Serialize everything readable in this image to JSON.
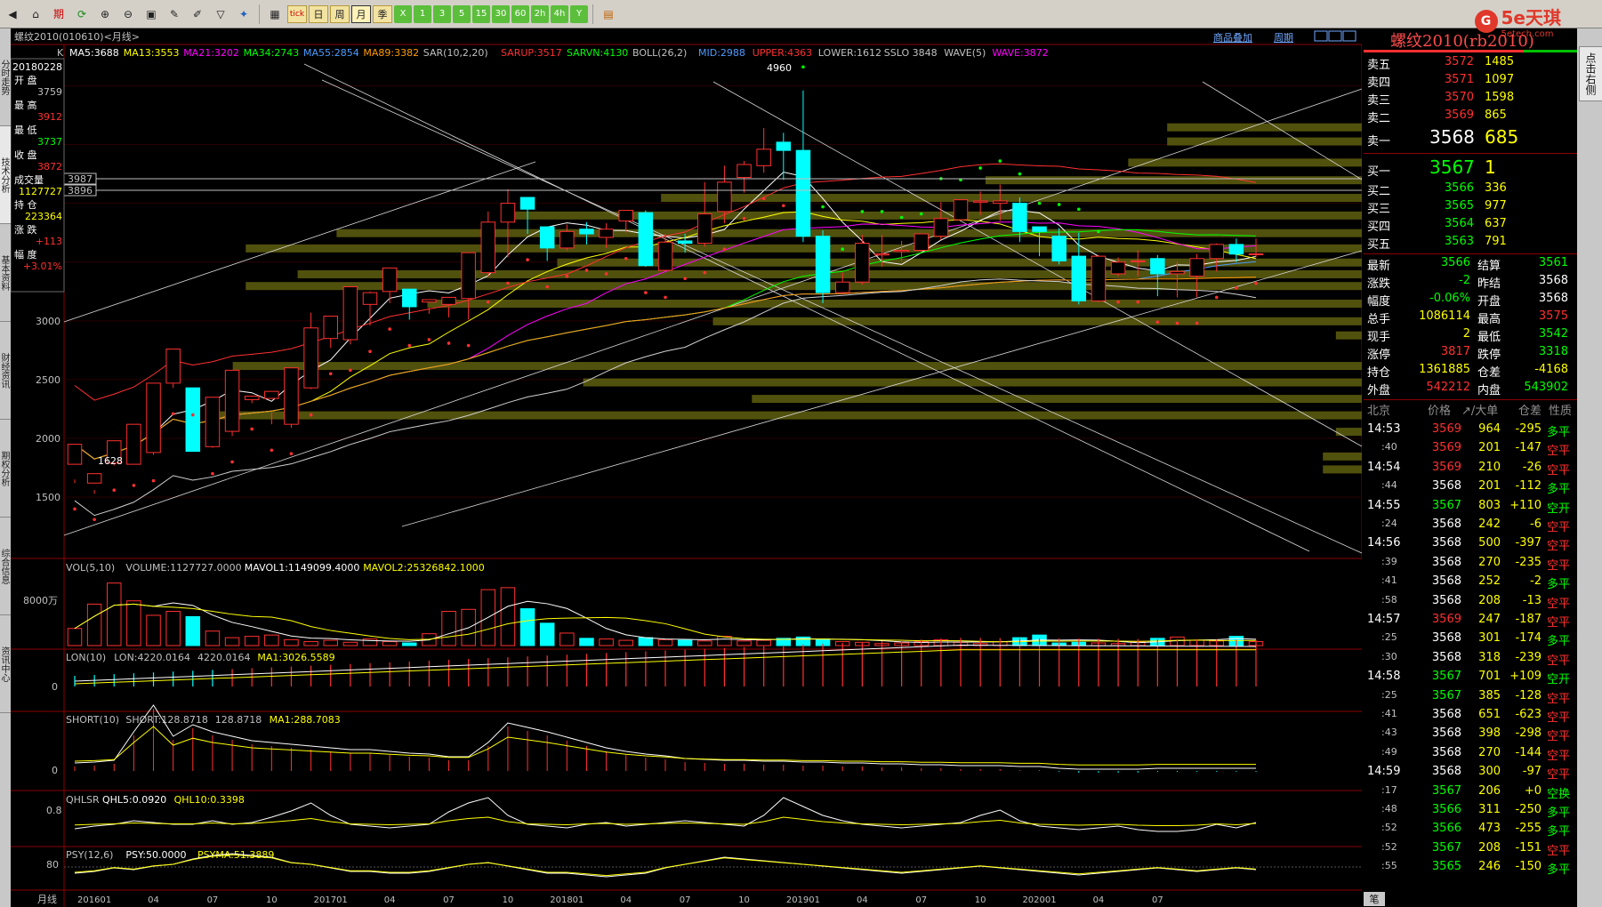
{
  "toolbar": {
    "icons": [
      "back-icon",
      "home-icon",
      "futures-icon",
      "refresh-icon",
      "zoom-in-icon",
      "zoom-out-icon",
      "window-icon",
      "draw-icon",
      "brush-icon",
      "filter-icon",
      "newsflash-icon",
      "table-icon"
    ],
    "period_buttons": [
      {
        "id": "tick",
        "label": "tick"
      },
      {
        "id": "day",
        "label": "日"
      },
      {
        "id": "week",
        "label": "周"
      },
      {
        "id": "month",
        "label": "月",
        "selected": true
      },
      {
        "id": "quarter",
        "label": "季"
      },
      {
        "id": "custom",
        "label": "X"
      }
    ],
    "minute_buttons": [
      "1",
      "3",
      "5",
      "15",
      "30",
      "60",
      "2h",
      "4h",
      "Y"
    ]
  },
  "brand": {
    "logo_char": "G",
    "name": "5e天琪",
    "sub": "5etech.com"
  },
  "left_tabs": [
    "分时走势",
    "技术分析",
    "基本资料",
    "财经资讯",
    "期权分析",
    "综合信息",
    "资讯中心"
  ],
  "right_tab": "点击右侧",
  "chart": {
    "title": "螺纹2010(010610)<月线>",
    "menu_add": "商品叠加",
    "menu_period": "周期",
    "ma_header": {
      "prefix": "K",
      "items": [
        {
          "text": "MA5:3688",
          "color": "#ffffff"
        },
        {
          "text": "MA13:3553",
          "color": "#ffff00"
        },
        {
          "text": "MA21:3202",
          "color": "#ff00ff"
        },
        {
          "text": "MA34:2743",
          "color": "#00ff00"
        },
        {
          "text": "MA55:2854",
          "color": "#4a9cff"
        },
        {
          "text": "MA89:3382",
          "color": "#ff9b00"
        },
        {
          "text": "SAR(10,2,20)",
          "color": "#c0c0c0"
        },
        {
          "text": "SARUP:3517",
          "color": "#ff3030"
        },
        {
          "text": "SARVN:4130",
          "color": "#00ff00"
        },
        {
          "text": "BOLL(26,2)",
          "color": "#c0c0c0"
        },
        {
          "text": "MID:2988",
          "color": "#4a9cff"
        },
        {
          "text": "UPPER:4363",
          "color": "#ff3030"
        },
        {
          "text": "LOWER:1612",
          "color": "#c0c0c0"
        },
        {
          "text": "SSLO 3848",
          "color": "#c0c0c0"
        },
        {
          "text": "WAVE(5)",
          "color": "#c0c0c0"
        },
        {
          "text": "WAVE:3872",
          "color": "#ff00ff"
        }
      ]
    },
    "info_box": {
      "date": "20180228",
      "labels": [
        "开 盘",
        "最 高",
        "最 低",
        "收 盘",
        "成交量",
        "持 仓",
        "涨 跌",
        "幅 度"
      ],
      "values": [
        "3759",
        "3912",
        "3737",
        "3872",
        "1127727",
        "223364",
        "+113",
        "+3.01%"
      ],
      "colors": [
        "#c0c0c0",
        "#ff3030",
        "#00ff00",
        "#ff3030",
        "#ffff00",
        "#ffff00",
        "#ff3030",
        "#ff3030"
      ]
    },
    "price_ticks": [
      "3000",
      "2500",
      "2000",
      "1500"
    ],
    "price_tick_values": [
      3000,
      2500,
      2000,
      1500
    ],
    "price_range": [
      1100,
      5200
    ],
    "price_tags": [
      "3987",
      "3896"
    ],
    "annot_high": "4960",
    "annot_low": "1628",
    "x_axis_labels": [
      "201601",
      "04",
      "07",
      "10",
      "201701",
      "04",
      "07",
      "10",
      "201801",
      "04",
      "07",
      "10",
      "201901",
      "04",
      "07",
      "10",
      "202001",
      "04",
      "07"
    ],
    "bottom_left_label": "月线",
    "candles": [
      [
        1780,
        1950,
        1650,
        1620
      ],
      [
        1620,
        1700,
        1560,
        1530
      ],
      [
        1790,
        1980,
        1770,
        1780
      ],
      [
        1780,
        2120,
        1880,
        1820
      ],
      [
        1880,
        2470,
        2110,
        1860
      ],
      [
        2470,
        2760,
        2520,
        2430
      ],
      [
        2430,
        1890,
        1910,
        2420
      ],
      [
        1930,
        2350,
        2050,
        1920
      ],
      [
        2060,
        2580,
        2330,
        2020
      ],
      [
        2330,
        2360,
        2340,
        2300
      ],
      [
        2340,
        2400,
        2220,
        2120
      ],
      [
        2120,
        2600,
        2430,
        2090
      ],
      [
        2430,
        2940,
        3070,
        2420
      ],
      [
        2850,
        3040,
        2890,
        2770
      ],
      [
        2840,
        3290,
        3140,
        2800
      ],
      [
        3140,
        3240,
        3250,
        2960
      ],
      [
        3250,
        3450,
        3330,
        3150
      ],
      [
        3270,
        3120,
        3180,
        3010
      ],
      [
        3160,
        3180,
        3110,
        3060
      ],
      [
        3140,
        3200,
        3120,
        3030
      ],
      [
        3190,
        3580,
        3330,
        3010
      ],
      [
        3410,
        3840,
        3930,
        3380
      ],
      [
        3840,
        4000,
        4120,
        3540
      ],
      [
        4050,
        3950,
        4040,
        3740
      ],
      [
        3800,
        3620,
        3800,
        3510
      ],
      [
        3620,
        3760,
        3820,
        3600
      ],
      [
        3780,
        3740,
        3840,
        3650
      ],
      [
        3710,
        3780,
        3830,
        3620
      ],
      [
        3850,
        3940,
        3920,
        3750
      ],
      [
        3920,
        3470,
        3940,
        3460
      ],
      [
        3430,
        3670,
        3740,
        3420
      ],
      [
        3680,
        3660,
        3740,
        3580
      ],
      [
        3660,
        3910,
        4180,
        3630
      ],
      [
        3930,
        4180,
        4320,
        3830
      ],
      [
        4220,
        4330,
        4360,
        4090
      ],
      [
        4320,
        4460,
        4640,
        4260
      ],
      [
        4520,
        4450,
        4600,
        4200
      ],
      [
        4450,
        3720,
        4960,
        3670
      ],
      [
        3720,
        3240,
        3770,
        3150
      ],
      [
        3240,
        3330,
        3410,
        3230
      ],
      [
        3330,
        3660,
        3730,
        3310
      ],
      [
        3560,
        3570,
        3730,
        3460
      ],
      [
        3590,
        3600,
        3680,
        3510
      ],
      [
        3600,
        3740,
        3710,
        3590
      ],
      [
        3720,
        3870,
        4010,
        3690
      ],
      [
        3860,
        4030,
        4000,
        3860
      ],
      [
        4010,
        4020,
        4100,
        3900
      ],
      [
        4000,
        4020,
        4160,
        3850
      ],
      [
        4000,
        3760,
        4050,
        3670
      ],
      [
        3800,
        3760,
        3800,
        3550
      ],
      [
        3720,
        3510,
        3790,
        3480
      ],
      [
        3550,
        3170,
        3750,
        3140
      ],
      [
        3170,
        3550,
        3560,
        3160
      ],
      [
        3400,
        3500,
        3540,
        3380
      ],
      [
        3510,
        3510,
        3600,
        3380
      ],
      [
        3530,
        3400,
        3560,
        3210
      ],
      [
        3400,
        3420,
        3500,
        3200
      ],
      [
        3380,
        3530,
        3570,
        3200
      ],
      [
        3530,
        3650,
        3660,
        3420
      ],
      [
        3650,
        3568,
        3700,
        3500
      ],
      [
        3568,
        3570,
        3700,
        3540
      ]
    ],
    "volumes": [
      2600,
      6300,
      9500,
      6800,
      4600,
      5200,
      4400,
      2200,
      1200,
      1400,
      1600,
      900,
      600,
      800,
      500,
      1000,
      600,
      400,
      1800,
      5200,
      5500,
      8500,
      8800,
      5600,
      3400,
      1900,
      1100,
      1000,
      800,
      1200,
      900,
      800,
      700,
      1400,
      700,
      800,
      1100,
      1300,
      1000,
      600,
      500,
      300,
      400,
      600,
      900,
      500,
      300,
      600,
      1200,
      1600,
      400,
      500,
      400,
      300,
      600,
      1100,
      1300,
      800,
      700,
      1400,
      600
    ],
    "vol_label": "8000万",
    "vol_header": [
      {
        "text": "VOL(5,10)",
        "color": "#c0c0c0"
      },
      {
        "text": "VOLUME:1127727.0000",
        "color": "#c0c0c0"
      },
      {
        "text": "MAVOL1:1149099.4000",
        "color": "#ffffff"
      },
      {
        "text": "MAVOL2:25326842.1000",
        "color": "#ffff00"
      }
    ],
    "lon_header": [
      {
        "text": "LON(10)",
        "color": "#c0c0c0"
      },
      {
        "text": "LON:4220.0164",
        "color": "#c0c0c0"
      },
      {
        "text": "4220.0164",
        "color": "#c0c0c0"
      },
      {
        "text": "MA1:3026.5589",
        "color": "#ffff00"
      }
    ],
    "lon_label": "0",
    "short_header": [
      {
        "text": "SHORT(10)",
        "color": "#c0c0c0"
      },
      {
        "text": "SHORT:128.8718",
        "color": "#c0c0c0"
      },
      {
        "text": "128.8718",
        "color": "#c0c0c0"
      },
      {
        "text": "MA1:288.7083",
        "color": "#ffff00"
      }
    ],
    "short_label": "0",
    "qhl_header": [
      {
        "text": "QHLSR",
        "color": "#c0c0c0"
      },
      {
        "text": "QHL5:0.0920",
        "color": "#ffffff"
      },
      {
        "text": "QHL10:0.3398",
        "color": "#ffff00"
      }
    ],
    "qhl_label": "0.8",
    "psy_header": [
      {
        "text": "PSY(12,6)",
        "color": "#c0c0c0"
      },
      {
        "text": "PSY:50.0000",
        "color": "#ffffff"
      },
      {
        "text": "PSYMA:51.3889",
        "color": "#ffff00"
      }
    ],
    "psy_label": "80"
  },
  "quote": {
    "title": "螺纹2010(rb2010)",
    "asks": [
      {
        "label": "卖五",
        "price": "3572",
        "vol": "1485"
      },
      {
        "label": "卖四",
        "price": "3571",
        "vol": "1097"
      },
      {
        "label": "卖三",
        "price": "3570",
        "vol": "1598"
      },
      {
        "label": "卖二",
        "price": "3569",
        "vol": "865"
      },
      {
        "label": "卖一",
        "price": "3568",
        "vol": "685"
      }
    ],
    "bids": [
      {
        "label": "买一",
        "price": "3567",
        "vol": "1"
      },
      {
        "label": "买二",
        "price": "3566",
        "vol": "336"
      },
      {
        "label": "买三",
        "price": "3565",
        "vol": "977"
      },
      {
        "label": "买四",
        "price": "3564",
        "vol": "637"
      },
      {
        "label": "买五",
        "price": "3563",
        "vol": "791"
      }
    ],
    "stats": [
      {
        "l1": "最新",
        "v1": "3566",
        "c1": "#00ff00",
        "l2": "结算",
        "v2": "3561",
        "c2": "#00ff00"
      },
      {
        "l1": "涨跌",
        "v1": "-2",
        "c1": "#00ff00",
        "l2": "昨结",
        "v2": "3568",
        "c2": "#ffffff"
      },
      {
        "l1": "幅度",
        "v1": "-0.06%",
        "c1": "#00ff00",
        "l2": "开盘",
        "v2": "3568",
        "c2": "#ffffff"
      },
      {
        "l1": "总手",
        "v1": "1086114",
        "c1": "#ffff00",
        "l2": "最高",
        "v2": "3575",
        "c2": "#ff3030"
      },
      {
        "l1": "现手",
        "v1": "2",
        "c1": "#ffff00",
        "l2": "最低",
        "v2": "3542",
        "c2": "#00ff00"
      },
      {
        "l1": "涨停",
        "v1": "3817",
        "c1": "#ff3030",
        "l2": "跌停",
        "v2": "3318",
        "c2": "#00ff00"
      },
      {
        "l1": "持仓",
        "v1": "1361885",
        "c1": "#ffff00",
        "l2": "仓差",
        "v2": "-4168",
        "c2": "#ffff00"
      },
      {
        "l1": "外盘",
        "v1": "542212",
        "c1": "#ff3030",
        "l2": "内盘",
        "v2": "543902",
        "c2": "#00ff00"
      }
    ],
    "tick_header": [
      "北京",
      "价格",
      "↗/大单",
      "仓差",
      "性质"
    ],
    "ticks": [
      {
        "t": "14:53",
        "p": "3569",
        "pc": "#ff3030",
        "v": "964",
        "d": "-295",
        "n": "多平",
        "nc": "#00ff00"
      },
      {
        "t": ":40",
        "p": "3569",
        "pc": "#ff3030",
        "v": "201",
        "d": "-147",
        "n": "空平",
        "nc": "#ff3030"
      },
      {
        "t": "14:54",
        "p": "3569",
        "pc": "#ff3030",
        "v": "210",
        "d": "-26",
        "n": "空平",
        "nc": "#ff3030"
      },
      {
        "t": ":44",
        "p": "3568",
        "pc": "#ffffff",
        "v": "201",
        "d": "-112",
        "n": "多平",
        "nc": "#00ff00"
      },
      {
        "t": "14:55",
        "p": "3567",
        "pc": "#00ff00",
        "v": "803",
        "d": "+110",
        "n": "空开",
        "nc": "#00ff00"
      },
      {
        "t": ":24",
        "p": "3568",
        "pc": "#ffffff",
        "v": "242",
        "d": "-6",
        "n": "空平",
        "nc": "#ff3030"
      },
      {
        "t": "14:56",
        "p": "3568",
        "pc": "#ffffff",
        "v": "500",
        "d": "-397",
        "n": "空平",
        "nc": "#ff3030"
      },
      {
        "t": ":39",
        "p": "3568",
        "pc": "#ffffff",
        "v": "270",
        "d": "-235",
        "n": "空平",
        "nc": "#ff3030"
      },
      {
        "t": ":41",
        "p": "3568",
        "pc": "#ffffff",
        "v": "252",
        "d": "-2",
        "n": "多平",
        "nc": "#00ff00"
      },
      {
        "t": ":58",
        "p": "3568",
        "pc": "#ffffff",
        "v": "208",
        "d": "-13",
        "n": "空平",
        "nc": "#ff3030"
      },
      {
        "t": "14:57",
        "p": "3569",
        "pc": "#ff3030",
        "v": "247",
        "d": "-187",
        "n": "空平",
        "nc": "#ff3030"
      },
      {
        "t": ":25",
        "p": "3568",
        "pc": "#ffffff",
        "v": "301",
        "d": "-174",
        "n": "多平",
        "nc": "#00ff00"
      },
      {
        "t": ":30",
        "p": "3568",
        "pc": "#ffffff",
        "v": "318",
        "d": "-239",
        "n": "空平",
        "nc": "#ff3030"
      },
      {
        "t": "14:58",
        "p": "3567",
        "pc": "#00ff00",
        "v": "701",
        "d": "+109",
        "n": "空开",
        "nc": "#00ff00"
      },
      {
        "t": ":25",
        "p": "3567",
        "pc": "#00ff00",
        "v": "385",
        "d": "-128",
        "n": "空平",
        "nc": "#ff3030"
      },
      {
        "t": ":41",
        "p": "3568",
        "pc": "#ffffff",
        "v": "651",
        "d": "-623",
        "n": "空平",
        "nc": "#ff3030"
      },
      {
        "t": ":43",
        "p": "3568",
        "pc": "#ffffff",
        "v": "398",
        "d": "-298",
        "n": "空平",
        "nc": "#ff3030"
      },
      {
        "t": ":49",
        "p": "3568",
        "pc": "#ffffff",
        "v": "270",
        "d": "-144",
        "n": "空平",
        "nc": "#ff3030"
      },
      {
        "t": "14:59",
        "p": "3568",
        "pc": "#ffffff",
        "v": "300",
        "d": "-97",
        "n": "空平",
        "nc": "#ff3030"
      },
      {
        "t": ":17",
        "p": "3567",
        "pc": "#00ff00",
        "v": "206",
        "d": "+0",
        "n": "空换",
        "nc": "#00ff00"
      },
      {
        "t": ":48",
        "p": "3566",
        "pc": "#00ff00",
        "v": "311",
        "d": "-250",
        "n": "多平",
        "nc": "#00ff00"
      },
      {
        "t": ":52",
        "p": "3566",
        "pc": "#00ff00",
        "v": "473",
        "d": "-255",
        "n": "多平",
        "nc": "#00ff00"
      },
      {
        "t": ":52",
        "p": "3567",
        "pc": "#00ff00",
        "v": "208",
        "d": "-151",
        "n": "空平",
        "nc": "#ff3030"
      },
      {
        "t": ":55",
        "p": "3565",
        "pc": "#00ff00",
        "v": "246",
        "d": "-150",
        "n": "多平",
        "nc": "#00ff00"
      }
    ],
    "bottom_tab": "笔"
  },
  "colors": {
    "up": "#ff3030",
    "down": "#00ffff",
    "grid": "#8b0000",
    "vband": "#5a5a10"
  }
}
